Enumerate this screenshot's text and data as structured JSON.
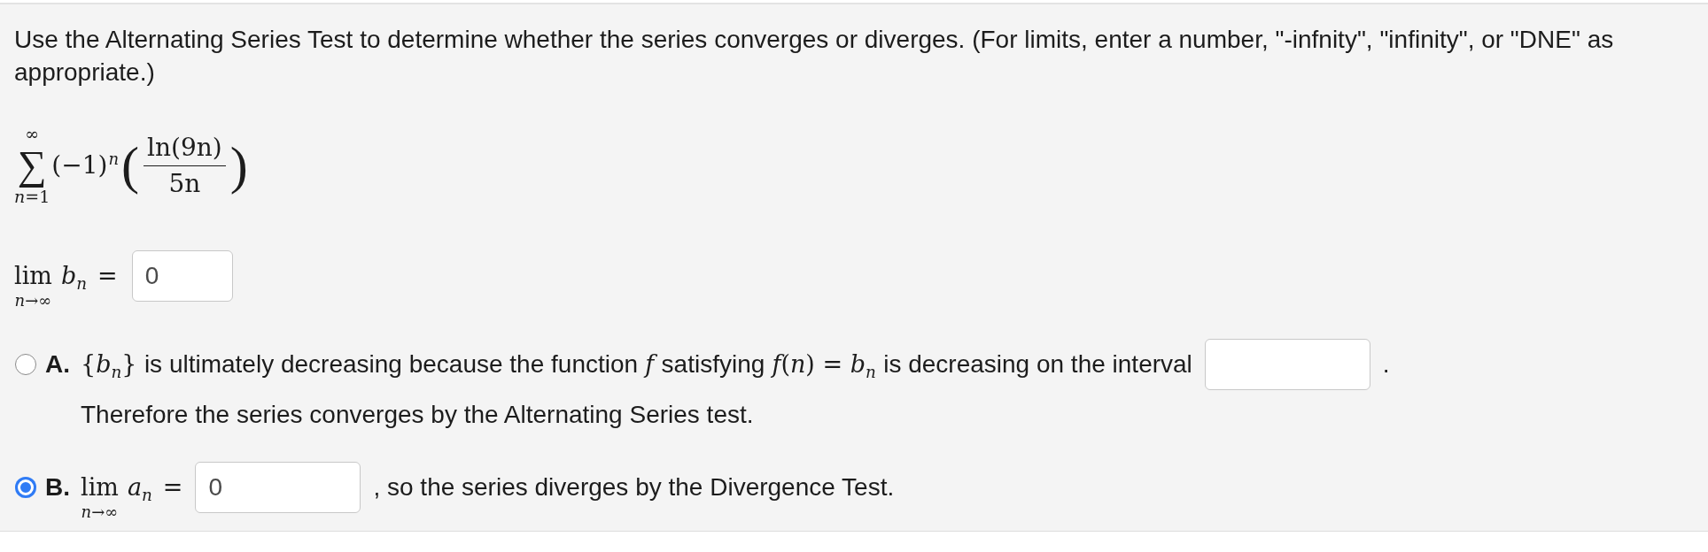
{
  "question": "Use the Alternating Series Test to determine whether the series converges or diverges. (For limits, enter a number, \"-infnity\", \"infinity\", or \"DNE\" as appropriate.)",
  "series": {
    "upper": "∞",
    "operator": "∑",
    "lower": "*n*=1",
    "factor": "(−1)",
    "exponent": "n",
    "left_paren": "(",
    "numerator": "ln(9n)",
    "denominator": "5n",
    "right_paren": ")"
  },
  "limit": {
    "operator": "lim",
    "under": "*n*→∞",
    "expression": "*b*$_{n}$",
    "relation": "=",
    "field": {
      "value": "0"
    }
  },
  "options": [
    {
      "label": "A.",
      "selected": false,
      "parts": [
        {
          "kind": "sentence",
          "segments": [
            {
              "kind": "math",
              "text": "{*b*$_{n}$}"
            },
            {
              "kind": "text",
              "text": "is ultimately decreasing because the function"
            },
            {
              "kind": "math",
              "text": "*f*"
            },
            {
              "kind": "text",
              "text": "satisfying"
            },
            {
              "kind": "math",
              "text": "*f*(*n*) = *b*$_{n}$"
            },
            {
              "kind": "text",
              "text": "is decreasing on the interval"
            }
          ]
        },
        {
          "kind": "field"
        },
        {
          "kind": "text",
          "text": "."
        }
      ],
      "note": "Therefore the series converges by the Alternating Series test."
    },
    {
      "label": "B.",
      "selected": true,
      "parts": [
        {
          "kind": "limit",
          "operator": "lim",
          "under": "*n*→∞",
          "expression": "*a*$_{n}$",
          "relation": "="
        },
        {
          "kind": "field",
          "value": "0"
        },
        {
          "kind": "text",
          "text": ", so the series diverges by the Divergence Test."
        }
      ]
    }
  ]
}
